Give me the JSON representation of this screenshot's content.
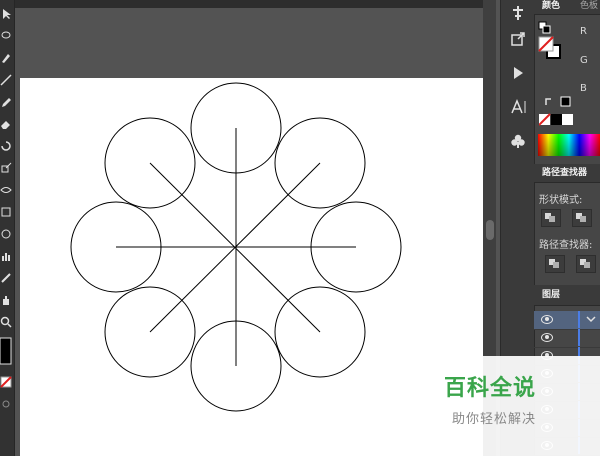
{
  "panel_tabs": {
    "color": "颜色",
    "swatches": "色板",
    "pathfinder": "路径查找器",
    "layers": "图层"
  },
  "color_panel": {
    "channels": [
      "R",
      "G",
      "B"
    ]
  },
  "pathfinder": {
    "shape_modes_label": "形状模式:",
    "pathfinders_label": "路径查找器:"
  },
  "watermark": {
    "title": "百科全说",
    "subtitle": "助你轻松解决"
  },
  "colors": {
    "canvas": "#535353",
    "artboard": "#ffffff",
    "layer_bar": "#4b7de6",
    "watermark_green": "#3aa54b"
  },
  "artwork": {
    "shape": "eight circles arranged around a center with eight radial lines"
  }
}
